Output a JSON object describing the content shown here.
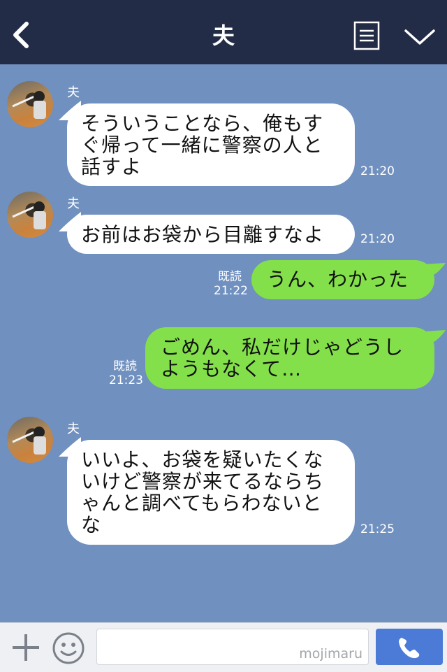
{
  "header": {
    "title": "夫",
    "icons": {
      "back": "chevron-left-icon",
      "notes": "notes-icon",
      "menu": "chevron-down-icon"
    },
    "background": "#232c46"
  },
  "chat": {
    "background": "#7090bf",
    "incoming_color": "#ffffff",
    "outgoing_color": "#84e04a",
    "messages": [
      {
        "sender": "夫",
        "text": "そういうことなら、俺もす\nぐ帰って一緒に警察の人と\n話すよ",
        "time": "21:20"
      },
      {
        "sender": "夫",
        "text": "お前はお袋から目離すなよ",
        "time": "21:20"
      },
      {
        "read_label": "既読",
        "time": "21:22",
        "text": "うん、わかった"
      },
      {
        "read_label": "既読",
        "time": "21:23",
        "text": "ごめん、私だけじゃどうし\nようもなくて…"
      },
      {
        "sender": "夫",
        "text": "いいよ、お袋を疑いたくな\nいけど警察が来てるならち\nゃんと調べてもらわないと\nな",
        "time": "21:25"
      }
    ]
  },
  "input_bar": {
    "value": "",
    "watermark": "mojimaru",
    "icons": {
      "add": "plus-icon",
      "sticker": "smile-icon",
      "call": "phone-icon"
    },
    "call_color": "#4b7bd6"
  }
}
